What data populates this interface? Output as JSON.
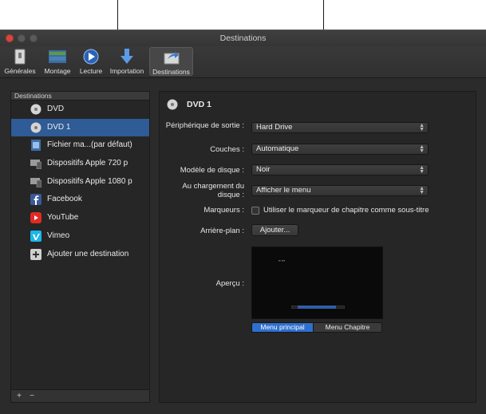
{
  "window": {
    "title": "Destinations"
  },
  "toolbar": {
    "items": [
      {
        "label": "Générales",
        "icon": "switch-icon"
      },
      {
        "label": "Montage",
        "icon": "timeline-icon"
      },
      {
        "label": "Lecture",
        "icon": "play-icon"
      },
      {
        "label": "Importation",
        "icon": "download-arrow-icon"
      },
      {
        "label": "Destinations",
        "icon": "share-icon",
        "selected": true
      }
    ]
  },
  "sidebar": {
    "header": "Destinations",
    "items": [
      {
        "label": "DVD",
        "icon": "disc-icon"
      },
      {
        "label": "DVD 1",
        "icon": "disc-icon",
        "selected": true
      },
      {
        "label": "Fichier ma...(par défaut)",
        "icon": "film-file-icon"
      },
      {
        "label": "Dispositifs Apple 720 p",
        "icon": "devices-icon"
      },
      {
        "label": "Dispositifs Apple 1080 p",
        "icon": "devices-icon"
      },
      {
        "label": "Facebook",
        "icon": "facebook-icon"
      },
      {
        "label": "YouTube",
        "icon": "youtube-icon"
      },
      {
        "label": "Vimeo",
        "icon": "vimeo-icon"
      },
      {
        "label": "Ajouter une destination",
        "icon": "plus-icon"
      }
    ],
    "add_label": "+",
    "remove_label": "−"
  },
  "panel": {
    "title": "DVD 1",
    "device_label": "Périphérique de sortie :",
    "device_value": "Hard Drive",
    "layers_label": "Couches :",
    "layers_value": "Automatique",
    "template_label": "Modèle de disque :",
    "template_value": "Noir",
    "onload_label": "Au chargement du disque :",
    "onload_value": "Afficher le menu",
    "markers_label": "Marqueurs :",
    "markers_checkbox": "Utiliser le marqueur de chapitre comme sous-titre",
    "background_label": "Arrière-plan :",
    "background_button": "Ajouter...",
    "preview_label": "Aperçu :",
    "preview_seg": [
      "Menu principal",
      "Menu Chapitre"
    ]
  },
  "colors": {
    "selection": "#2f5b96",
    "segment_active": "#2f6fce"
  }
}
